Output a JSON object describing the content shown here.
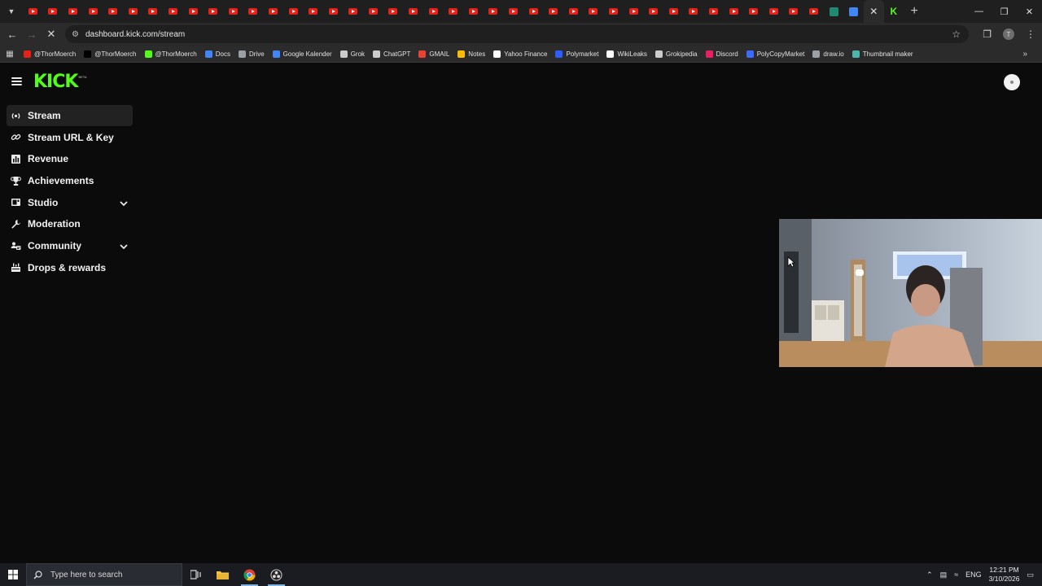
{
  "browser": {
    "tab_count_youtube": 40,
    "url": "dashboard.kick.com/stream",
    "bookmarks": [
      {
        "label": "@ThorMoerch",
        "icon": "youtube-icon",
        "color": "#e62117"
      },
      {
        "label": "@ThorMoerch",
        "icon": "x-icon",
        "color": "#000000"
      },
      {
        "label": "@ThorMoerch",
        "icon": "kick-icon",
        "color": "#53fc18"
      },
      {
        "label": "Docs",
        "icon": "docs-icon",
        "color": "#4285f4"
      },
      {
        "label": "Drive",
        "icon": "drive-icon",
        "color": "#9aa0a6"
      },
      {
        "label": "Google Kalender",
        "icon": "calendar-icon",
        "color": "#4285f4"
      },
      {
        "label": "Grok",
        "icon": "grok-icon",
        "color": "#cccccc"
      },
      {
        "label": "ChatGPT",
        "icon": "chatgpt-icon",
        "color": "#cccccc"
      },
      {
        "label": "GMAIL",
        "icon": "gmail-icon",
        "color": "#ea4335"
      },
      {
        "label": "Notes",
        "icon": "notes-icon",
        "color": "#fbbc04"
      },
      {
        "label": "Yahoo Finance",
        "icon": "yahoo-icon",
        "color": "#ffffff"
      },
      {
        "label": "Polymarket",
        "icon": "polymarket-icon",
        "color": "#2e5cff"
      },
      {
        "label": "WikiLeaks",
        "icon": "wikileaks-icon",
        "color": "#ffffff"
      },
      {
        "label": "Grokipedia",
        "icon": "grokipedia-icon",
        "color": "#cccccc"
      },
      {
        "label": "Discord",
        "icon": "discord-icon",
        "color": "#e91e63"
      },
      {
        "label": "PolyCopyMarket",
        "icon": "polycopy-icon",
        "color": "#3d6bff"
      },
      {
        "label": "draw.io",
        "icon": "drawio-icon",
        "color": "#9aa0a6"
      },
      {
        "label": "Thumbnail maker",
        "icon": "thumbnail-icon",
        "color": "#4db6ac"
      }
    ]
  },
  "app": {
    "logo": "KICK",
    "logo_badge": "BETA",
    "accent": "#53fc18"
  },
  "sidebar": {
    "items": [
      {
        "label": "Stream",
        "icon": "broadcast-icon",
        "active": true,
        "expandable": false
      },
      {
        "label": "Stream URL & Key",
        "icon": "link-icon",
        "active": false,
        "expandable": false
      },
      {
        "label": "Revenue",
        "icon": "chart-icon",
        "active": false,
        "expandable": false
      },
      {
        "label": "Achievements",
        "icon": "trophy-icon",
        "active": false,
        "expandable": false
      },
      {
        "label": "Studio",
        "icon": "studio-icon",
        "active": false,
        "expandable": true
      },
      {
        "label": "Moderation",
        "icon": "wrench-icon",
        "active": false,
        "expandable": false
      },
      {
        "label": "Community",
        "icon": "community-icon",
        "active": false,
        "expandable": true
      },
      {
        "label": "Drops & rewards",
        "icon": "gift-icon",
        "active": false,
        "expandable": false
      }
    ]
  },
  "taskbar": {
    "search_placeholder": "Type here to search",
    "language": "ENG",
    "time": "12:21 PM",
    "date": "3/10/2026"
  }
}
